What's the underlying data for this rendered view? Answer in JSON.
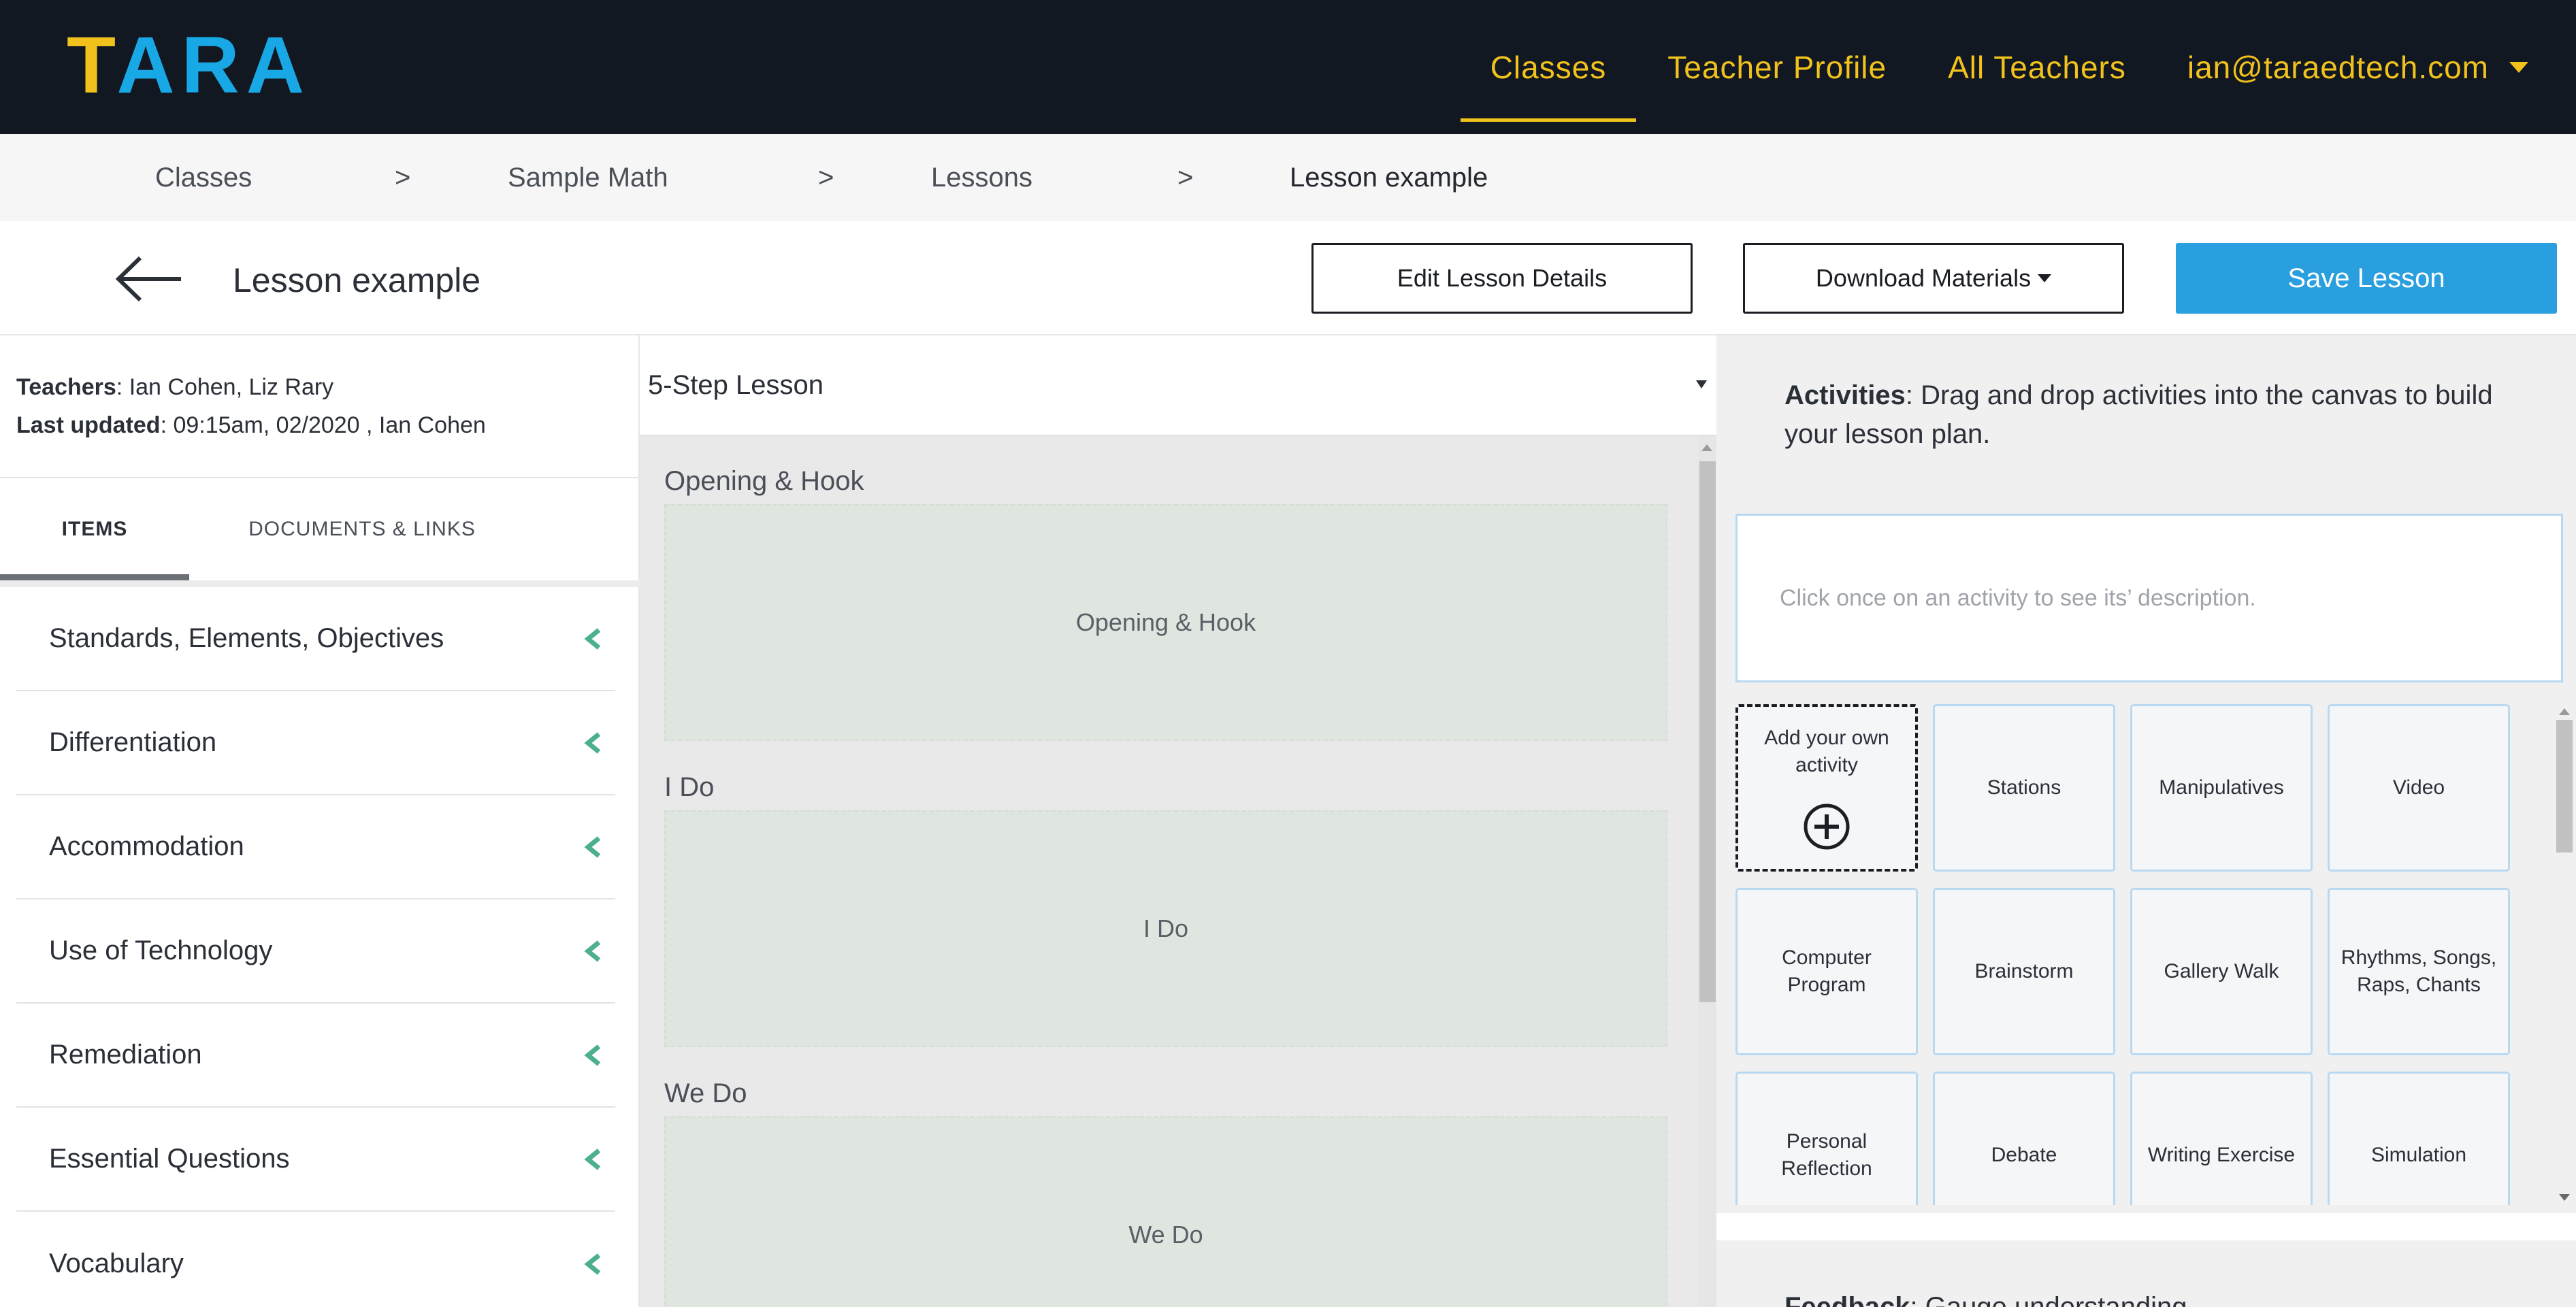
{
  "app": {
    "logo": "TARA"
  },
  "nav": {
    "items": [
      {
        "label": "Classes",
        "active": true
      },
      {
        "label": "Teacher Profile",
        "active": false
      },
      {
        "label": "All Teachers",
        "active": false
      }
    ],
    "user_email": "ian@taraedtech.com"
  },
  "breadcrumb": {
    "items": [
      "Classes",
      "Sample Math",
      "Lessons",
      "Lesson example"
    ],
    "separator": ">"
  },
  "header": {
    "title": "Lesson example",
    "edit_label": "Edit Lesson Details",
    "download_label": "Download Materials",
    "save_label": "Save Lesson"
  },
  "lesson_meta": {
    "teachers_label": "Teachers",
    "teachers_value": ": Ian Cohen,  Liz Rary",
    "updated_label": "Last updated",
    "updated_value": ": 09:15am, 02/2020 ,  Ian Cohen"
  },
  "left_tabs": [
    {
      "label": "ITEMS",
      "active": true
    },
    {
      "label": "DOCUMENTS & LINKS",
      "active": false
    }
  ],
  "accordion": [
    "Standards, Elements, Objectives",
    "Differentiation",
    "Accommodation",
    "Use of Technology",
    "Remediation",
    "Essential Questions",
    "Vocabulary"
  ],
  "canvas": {
    "template": "5-Step Lesson",
    "steps": [
      {
        "label": "Opening & Hook",
        "box": "Opening & Hook"
      },
      {
        "label": "I Do",
        "box": "I Do"
      },
      {
        "label": "We Do",
        "box": "We Do"
      }
    ]
  },
  "activities": {
    "intro_bold": "Activities",
    "intro_text": ": Drag and drop activities into the canvas to build your lesson plan.",
    "description_placeholder": "Click once on an activity to see its’ description.",
    "add_label": "Add your own activity",
    "cards": [
      "Stations",
      "Manipulatives",
      "Video",
      "Computer Program",
      "Brainstorm",
      "Gallery Walk",
      "Rhythms, Songs, Raps, Chants",
      "Personal Reflection",
      "Debate",
      "Writing Exercise",
      "Simulation"
    ]
  },
  "feedback": {
    "bold": "Feedback",
    "text": ": Gauge understanding"
  },
  "colors": {
    "nav_bg": "#111822",
    "accent_yellow": "#f2c21c",
    "brand_blue": "#19a8e6",
    "primary_button": "#2a9fdf",
    "chevron_green": "#4caf8f"
  }
}
